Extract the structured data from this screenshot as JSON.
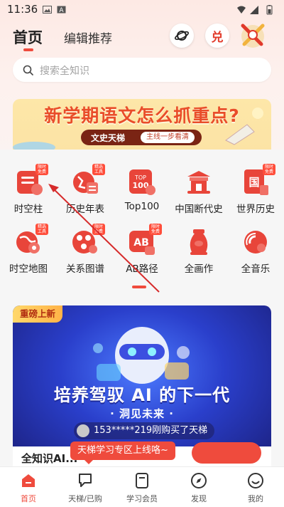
{
  "status_bar": {
    "time": "11:36"
  },
  "header": {
    "tabs": [
      {
        "label": "首页"
      },
      {
        "label": "编辑推荐"
      }
    ],
    "redeem_label": "兑"
  },
  "search": {
    "placeholder": "搜索全知识"
  },
  "banner": {
    "title": "新学期语文怎么抓重点?",
    "brand": "文史天梯",
    "slogan": "主线一步看清"
  },
  "grid": {
    "row1": [
      {
        "label": "时空柱",
        "badge": "限时 免费"
      },
      {
        "label": "历史年表",
        "badge": "精选 工具"
      },
      {
        "label": "Top100",
        "badge": "",
        "icon_text": "TOP 100"
      },
      {
        "label": "中国断代史",
        "badge": ""
      },
      {
        "label": "世界历史",
        "badge": "限时 免费",
        "icon_text": "国"
      }
    ],
    "row2": [
      {
        "label": "时空地图",
        "badge": "精选 工具"
      },
      {
        "label": "关系图谱",
        "badge": "限时 免费"
      },
      {
        "label": "AB路径",
        "badge": "限时 免费",
        "icon_text": "AB"
      },
      {
        "label": "全画作",
        "badge": ""
      },
      {
        "label": "全音乐",
        "badge": ""
      }
    ]
  },
  "promo": {
    "tag": "重磅上新",
    "slogan": "培养驾驭 AI 的下一代",
    "sub": "· 洞见未来 ·",
    "buyer": "153*****219刚购买了天梯",
    "bottom_title": "全知识AI..."
  },
  "tooltip": "天梯学习专区上线咯~",
  "bottom_nav": [
    {
      "label": "首页"
    },
    {
      "label": "天梯/已购"
    },
    {
      "label": "学习会员"
    },
    {
      "label": "发现"
    },
    {
      "label": "我的"
    }
  ],
  "colors": {
    "accent": "#ef4b3d",
    "banner_title": "#e94d2a",
    "promo_bg": "#2a3fcb"
  }
}
